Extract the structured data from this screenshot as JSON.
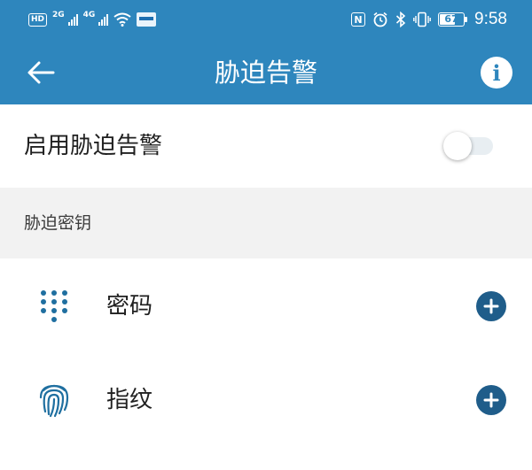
{
  "status_bar": {
    "hd_label": "HD",
    "network_1": "2G",
    "network_2": "4G",
    "nfc_label": "N",
    "battery_level": 67,
    "battery_text": "67",
    "time": "9:58"
  },
  "header": {
    "title": "胁迫告警",
    "back_icon": "arrow-left-icon",
    "info_icon": "info-icon",
    "info_glyph": "i",
    "color": "#2e86bd"
  },
  "toggle": {
    "label": "启用胁迫告警",
    "enabled": false
  },
  "section": {
    "label": "胁迫密钥"
  },
  "items": [
    {
      "label": "密码",
      "icon": "keypad-icon",
      "action_icon": "add-icon"
    },
    {
      "label": "指纹",
      "icon": "fingerprint-icon",
      "action_icon": "add-icon"
    }
  ],
  "colors": {
    "accent": "#2e86bd",
    "add_button": "#1f5d8a",
    "icon": "#1f6fa0"
  }
}
